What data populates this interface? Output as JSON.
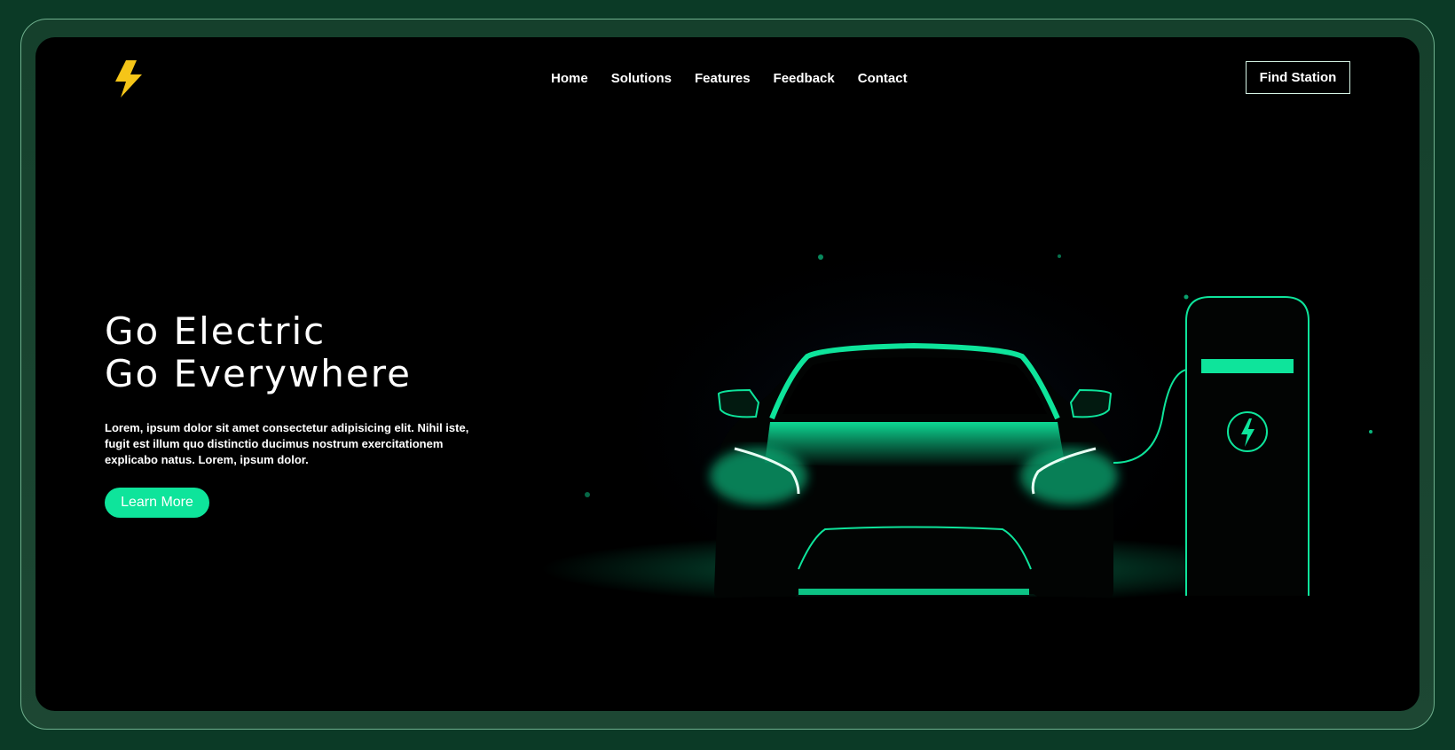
{
  "header": {
    "logo_icon": "lightning-bolt-icon",
    "nav": [
      {
        "label": "Home"
      },
      {
        "label": "Solutions"
      },
      {
        "label": "Features"
      },
      {
        "label": "Feedback"
      },
      {
        "label": "Contact"
      }
    ],
    "cta_label": "Find Station"
  },
  "hero": {
    "title_line1": "Go Electric",
    "title_line2": "Go Everywhere",
    "text": "Lorem, ipsum dolor sit amet consectetur adipisicing elit. Nihil iste, fugit est illum quo distinctio ducimus nostrum exercitationem explicabo natus. Lorem, ipsum dolor.",
    "button_label": "Learn More"
  },
  "illustration": {
    "car_icon": "electric-car-icon",
    "charger_icon": "charging-station-icon"
  },
  "colors": {
    "accent": "#0ee49b",
    "logo": "#f5c518",
    "background": "#000000",
    "frame": "#0b3a26"
  }
}
